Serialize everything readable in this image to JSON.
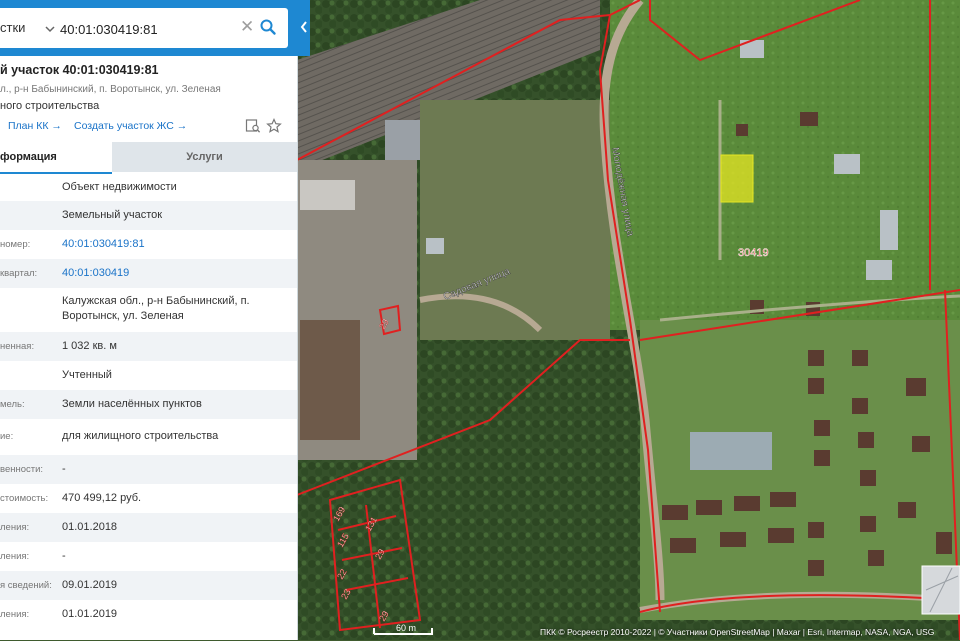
{
  "search": {
    "type_label": "стки",
    "query": "40:01:030419:81"
  },
  "object": {
    "title": "й участок 40:01:030419:81",
    "address": "л., р-н Бабынинский, п. Воротынск, ул. Зеленая",
    "purpose": "ного строительства"
  },
  "links": {
    "plan": "План КК →",
    "create": "Создать участок ЖС →"
  },
  "tabs": {
    "info": "формация",
    "services": "Услуги"
  },
  "rows": [
    {
      "label": "",
      "value": "Объект недвижимости"
    },
    {
      "label": "",
      "value": "Земельный участок"
    },
    {
      "label": "номер:",
      "value": "40:01:030419:81"
    },
    {
      "label": "квартал:",
      "value": "40:01:030419"
    },
    {
      "label": "",
      "value": "Калужская обл., р-н Бабынинский, п. Воротынск, ул. Зеленая"
    },
    {
      "label": "ненная:",
      "value": "1 032 кв. м"
    },
    {
      "label": "",
      "value": "Учтенный"
    },
    {
      "label": "мель:",
      "value": "Земли населённых пунктов"
    },
    {
      "label": "ие:",
      "value": "для жилищного строительства"
    },
    {
      "label": "венности:",
      "value": "-"
    },
    {
      "label": "стоимость:",
      "value": "470 499,12 руб."
    },
    {
      "label": "ления:",
      "value": "01.01.2018"
    },
    {
      "label": "ления:",
      "value": "-"
    },
    {
      "label": "я сведений:",
      "value": "09.01.2019"
    },
    {
      "label": "ления:",
      "value": "01.01.2019"
    }
  ],
  "map": {
    "streets": [
      "Молодёжная улица",
      "Садовая улица"
    ],
    "parcel_labels": [
      "30419",
      "169",
      "131",
      "115",
      "29",
      "22",
      "23",
      "29",
      "29"
    ],
    "scale_label": "60 m",
    "attribution": "ПКК © Росреестр 2010-2022 | © Участники OpenStreetMap | Maxar | Esri, Intermap, NASA, NGA, USG"
  },
  "colors": {
    "accent": "#1e88d2",
    "link": "#1a73c8",
    "boundary": "#e02020",
    "highlight": "#e6e623"
  }
}
